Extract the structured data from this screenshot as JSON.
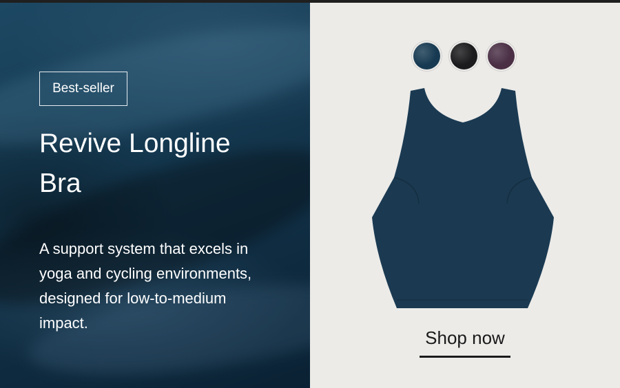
{
  "hero": {
    "badge": "Best-seller",
    "title_line1": "Revive Longline",
    "title_line2": "Bra",
    "description": "A support system that excels in yoga and cycling environments, designed for low-to-medium impact."
  },
  "product": {
    "swatches": [
      {
        "name": "navy",
        "color": "#173a52"
      },
      {
        "name": "black",
        "color": "#1b1b1d"
      },
      {
        "name": "plum",
        "color": "#4a2f45"
      }
    ],
    "product_color": "#1b3a52"
  },
  "cta": {
    "shop_now_label": "Shop now"
  },
  "colors": {
    "left_bg": "#153a52",
    "right_bg": "#ecebe8",
    "text_light": "#ffffff",
    "text_dark": "#1a1a1a"
  }
}
